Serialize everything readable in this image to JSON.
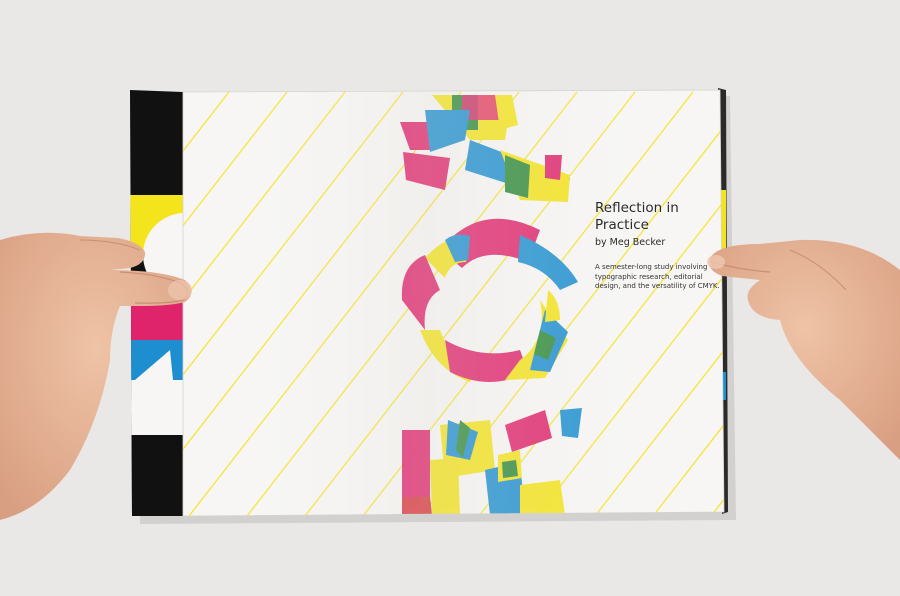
{
  "booklet": {
    "title": "Reflection in Practice",
    "author": "by Meg Becker",
    "description": "A semester-long study involving typographic research, editorial design, and the versatility of CMYK."
  },
  "colors": {
    "cyan": "#1d8fd0",
    "magenta": "#e0246c",
    "yellow": "#f4e41c",
    "overlap_green": "#2f8a3a",
    "overlap_red": "#d8343a",
    "black": "#111111",
    "paper": "#f7f6f4",
    "background": "#e9e8e6",
    "skin": "#e8b79a"
  }
}
